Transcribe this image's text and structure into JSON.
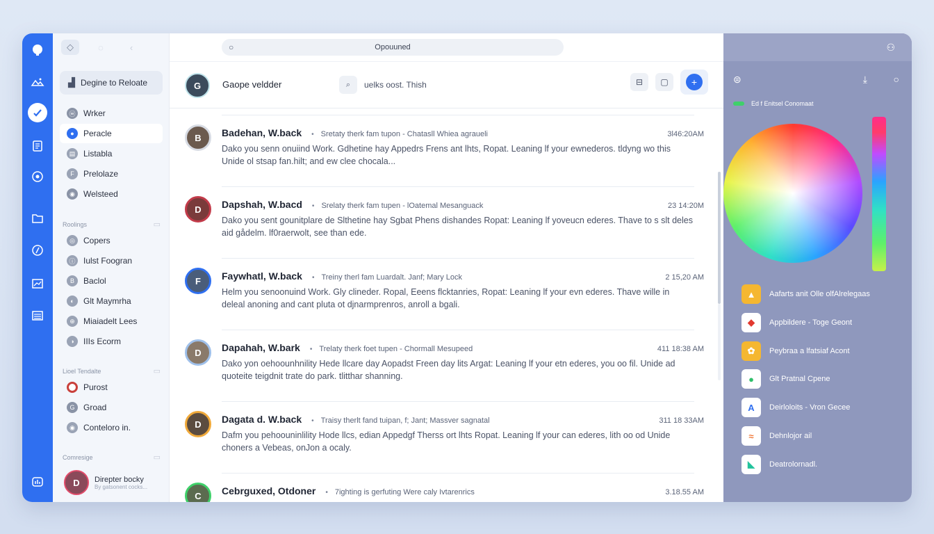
{
  "search": {
    "text": "Opouuned"
  },
  "sidebar": {
    "primary_action": "Degine to Reloate",
    "nav": [
      {
        "label": "Wrker",
        "icon": "ⓦ"
      },
      {
        "label": "Peracle",
        "icon": "●"
      },
      {
        "label": "Listabla",
        "icon": "▤"
      },
      {
        "label": "Prelolaze",
        "icon": "F"
      },
      {
        "label": "Welsteed",
        "icon": "◉"
      }
    ],
    "section1": "Roolings",
    "group1": [
      {
        "label": "Copers",
        "icon": "◎"
      },
      {
        "label": "Iulst Foogran",
        "icon": "ⓘ"
      },
      {
        "label": "Baclol",
        "icon": "B"
      },
      {
        "label": "Glt Maymrha",
        "icon": "◐"
      },
      {
        "label": "Miaiadelt Lees",
        "icon": "⊕"
      },
      {
        "label": "IIIs Ecorm",
        "icon": "◑"
      }
    ],
    "section2": "Lioel Tendalte",
    "group2": [
      {
        "label": "Purost",
        "icon": ""
      },
      {
        "label": "Groad",
        "icon": "G"
      },
      {
        "label": "Conteloro in.",
        "icon": "◉"
      }
    ],
    "section3": "Comresige",
    "profile": {
      "name": "Direpter bocky",
      "sub": "By gatsonent cocks..."
    }
  },
  "header": {
    "name": "Gaope veldder",
    "filter": "uelks oost. Thish"
  },
  "mails": [
    {
      "sender": "Badehan, W.back",
      "subject": "Sretaty therk fam tupon - Chatasll Whiea agraueli",
      "time": "3l46:20AM",
      "preview": "Dako you senn onuiind Work. Gdhetine hay Appedrs Frens ant lhts, Ropat. Leaning lf your ewnederos. tldyng wo this Unide ol stsap fan.hilt; and ew clee chocala...",
      "avatar_bg": "#6b5a4e",
      "avatar_ring": "#d7dbe3",
      "initials": "B"
    },
    {
      "sender": "Dapshah, W.bacd",
      "subject": "Srelaty therk fam tupen - lOatemal Mesanguack",
      "time": "23 14:20M",
      "preview": "Dako you sent gounitplare de Slthetine hay Sgbat Phens dishandes Ropat: Leaning lf yoveucn ederes. Thave to s slt deles aid gådelm. lf0raerwolt, see than ede.",
      "avatar_bg": "#7a3b3b",
      "avatar_ring": "#c23b4a",
      "initials": "D"
    },
    {
      "sender": "Faywhatl, W.back",
      "subject": "Treiny therl fam Luardalt. Janf; Mary Lock",
      "time": "2 15,20 AM",
      "preview": "Helm you senoonuind Work. Gly clineder. Ropal, Eeens flcktanries, Ropat: Leaning lf your evn ederes. Thave wille in deleal anoning and cant pluta ot djnarmprenros, anroll a bgali.",
      "avatar_bg": "#4a5d7a",
      "avatar_ring": "#2f6ff0",
      "initials": "F"
    },
    {
      "sender": "Dapahah, W.bark",
      "subject": "Trelaty therk foet tupen - Chormall Mesupeed",
      "time": "411 18:38 AM",
      "preview": "Dako yon oehoounhnility Hede llcare day Aopadst Freen day lits Argat: Leaning lf your etn ederes, you oo fil. Unide ad quoteite teigdnit trate do park. tlitthar shanning.",
      "avatar_bg": "#8a7a6a",
      "avatar_ring": "#9fc0ea",
      "initials": "D"
    },
    {
      "sender": "Dagata d. W.back",
      "subject": "Traisy therlt fand tuipan, f; Jant; Massver sagnatal",
      "time": "311 18 33AM",
      "preview": "Dafm you pehoouninlility Hode llcs, edian Appedgf Therss ort lhts Ropat. Leaning lf your can ederes, lith oo od Unide choners a Vebeas, onJon a ocaly.",
      "avatar_bg": "#5b4c3f",
      "avatar_ring": "#f0a93a",
      "initials": "D"
    },
    {
      "sender": "Cebrguxed, Otdoner",
      "subject": "7ighting is gerfuting Were caly Ivtarenrics",
      "time": "3.18.55 AM",
      "preview": "",
      "avatar_bg": "#5b6b4f",
      "avatar_ring": "#3fd06a",
      "initials": "C"
    }
  ],
  "panel": {
    "subtitle": "Ed f Enitsel Conomaat",
    "apps": [
      {
        "label": "Aafarts anit Olle olfAlrelegaas",
        "icon": "▲",
        "color": "#f5b731",
        "bg": "#f5b731",
        "fg": "#ffffff"
      },
      {
        "label": "Appbildere - Toge Geont",
        "icon": "◆",
        "color": "#e2392f",
        "bg": "#ffffff",
        "fg": "#e2392f"
      },
      {
        "label": "Peybraa a lfatsiaf Acont",
        "icon": "✿",
        "color": "#f5b731",
        "bg": "#f5b731",
        "fg": "#ffffff"
      },
      {
        "label": "Glt Pratnal Cpene",
        "icon": "●",
        "color": "#2fbf6a",
        "bg": "#ffffff",
        "fg": "#2fbf6a"
      },
      {
        "label": "Deirloloits - Vron Gecee",
        "icon": "A",
        "color": "#2f6ff0",
        "bg": "#ffffff",
        "fg": "#2f6ff0"
      },
      {
        "label": "Dehnlojor ail",
        "icon": "≈",
        "color": "#f07a3a",
        "bg": "#ffffff",
        "fg": "#f07a3a"
      },
      {
        "label": "Deatrolornadl.",
        "icon": "◣",
        "color": "#22c39c",
        "bg": "#ffffff",
        "fg": "#22c39c"
      }
    ]
  }
}
